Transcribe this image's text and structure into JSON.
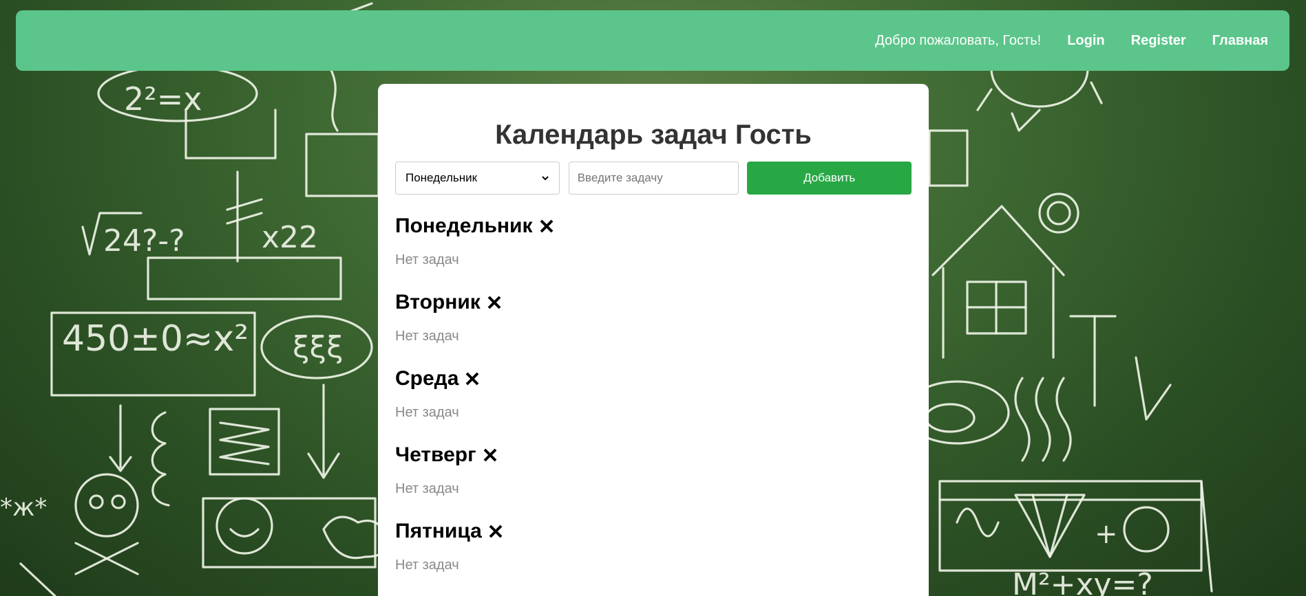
{
  "nav": {
    "welcome": "Добро пожаловать, Гость!",
    "links": [
      "Login",
      "Register",
      "Главная"
    ]
  },
  "page": {
    "title": "Календарь задач Гость"
  },
  "form": {
    "selected_day": "Понедельник",
    "task_placeholder": "Введите задачу",
    "add_label": "Добавить"
  },
  "days": [
    {
      "name": "Понедельник",
      "empty_text": "Нет задач"
    },
    {
      "name": "Вторник",
      "empty_text": "Нет задач"
    },
    {
      "name": "Среда",
      "empty_text": "Нет задач"
    },
    {
      "name": "Четверг",
      "empty_text": "Нет задач"
    },
    {
      "name": "Пятница",
      "empty_text": "Нет задач"
    }
  ],
  "colors": {
    "navbar": "#5cc58b",
    "add_button": "#28a745",
    "chalkboard": "#3f6a33"
  },
  "icons": {
    "delete_day": "close-icon",
    "select_arrow": "chevron-down-icon"
  }
}
